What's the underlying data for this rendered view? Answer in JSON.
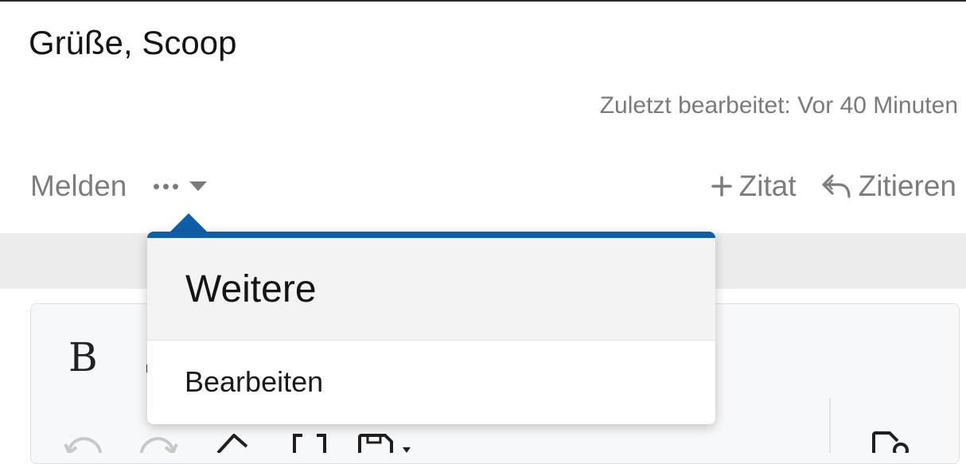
{
  "post": {
    "signature": "Grüße, Scoop",
    "last_edited": "Zuletzt bearbeitet: Vor 40 Minuten"
  },
  "actions": {
    "report": "Melden",
    "more_icon": "more-dots-icon",
    "quote_add": "Zitat",
    "quote_reply": "Zitieren"
  },
  "dropdown": {
    "header": "Weitere",
    "items": [
      {
        "label": "Bearbeiten"
      }
    ]
  },
  "editor": {
    "bold_label": "B",
    "toolbar_icons": [
      "undo-icon",
      "redo-icon",
      "eraser-icon",
      "brackets-icon",
      "save-draft-icon",
      "preview-icon"
    ]
  },
  "colors": {
    "accent": "#0f5fa8",
    "muted_text": "#7d7d7d",
    "band": "#ececec"
  }
}
